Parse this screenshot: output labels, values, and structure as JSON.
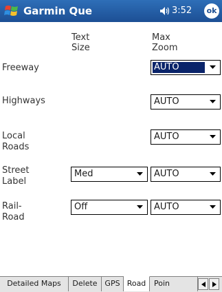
{
  "window": {
    "title": "Garmin Que",
    "clock": "3:52",
    "ok_label": "ok"
  },
  "columns": {
    "text_size": [
      "Text",
      "Size"
    ],
    "max_zoom": [
      "Max",
      "Zoom"
    ]
  },
  "rows": [
    {
      "label": [
        "Freeway"
      ],
      "max_zoom": "AUTO"
    },
    {
      "label": [
        "Highways"
      ],
      "max_zoom": "AUTO"
    },
    {
      "label": [
        "Local",
        "Roads"
      ],
      "max_zoom": "AUTO"
    },
    {
      "label": [
        "Street",
        "Label"
      ],
      "text_size": "Med",
      "max_zoom": "AUTO"
    },
    {
      "label": [
        "Rail-",
        "Road"
      ],
      "text_size": "Off",
      "max_zoom": "AUTO"
    }
  ],
  "tabs": [
    {
      "label": "Detailed Maps"
    },
    {
      "label": "Delete"
    },
    {
      "label": "GPS"
    },
    {
      "label": "Road"
    },
    {
      "label": "Poin"
    }
  ],
  "active_tab": "Road",
  "colors": {
    "titlebar": "#1c4f94",
    "selection": "#0a246a"
  }
}
